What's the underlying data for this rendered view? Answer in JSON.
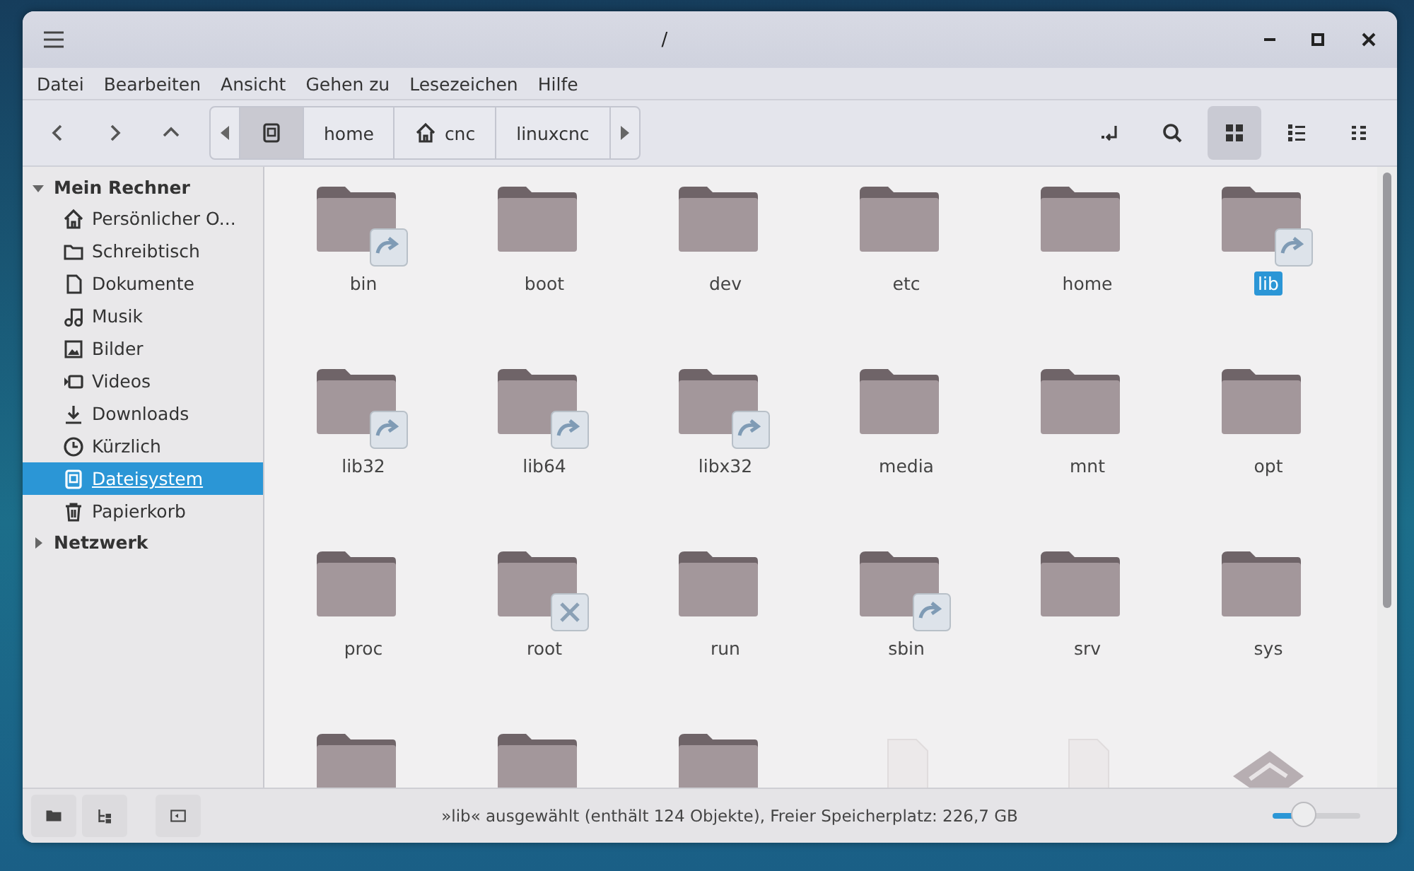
{
  "window": {
    "title": "/"
  },
  "menu": [
    "Datei",
    "Bearbeiten",
    "Ansicht",
    "Gehen zu",
    "Lesezeichen",
    "Hilfe"
  ],
  "path": [
    {
      "kind": "drive",
      "selected": true
    },
    {
      "kind": "plain",
      "label": "home",
      "selected": false
    },
    {
      "kind": "home",
      "label": "cnc",
      "selected": false
    },
    {
      "kind": "plain",
      "label": "linuxcnc",
      "selected": false
    }
  ],
  "view_modes": [
    {
      "kind": "icons",
      "selected": true
    },
    {
      "kind": "list",
      "selected": false
    },
    {
      "kind": "compact",
      "selected": false
    }
  ],
  "sidebar": [
    {
      "label": "Mein Rechner",
      "expanded": true,
      "items": [
        {
          "kind": "home",
          "label": "Persönlicher O...",
          "selected": false
        },
        {
          "kind": "folder",
          "label": "Schreibtisch",
          "selected": false
        },
        {
          "kind": "document",
          "label": "Dokumente",
          "selected": false
        },
        {
          "kind": "music",
          "label": "Musik",
          "selected": false
        },
        {
          "kind": "image",
          "label": "Bilder",
          "selected": false
        },
        {
          "kind": "video",
          "label": "Videos",
          "selected": false
        },
        {
          "kind": "download",
          "label": "Downloads",
          "selected": false
        },
        {
          "kind": "clock",
          "label": "Kürzlich",
          "selected": false
        },
        {
          "kind": "drive",
          "label": "Dateisystem",
          "selected": true
        },
        {
          "kind": "trash",
          "label": "Papierkorb",
          "selected": false
        }
      ]
    },
    {
      "label": "Netzwerk",
      "expanded": false
    }
  ],
  "files": [
    {
      "name": "bin",
      "kind": "link",
      "selected": false
    },
    {
      "name": "boot",
      "kind": "folder",
      "selected": false
    },
    {
      "name": "dev",
      "kind": "folder",
      "selected": false
    },
    {
      "name": "etc",
      "kind": "folder",
      "selected": false
    },
    {
      "name": "home",
      "kind": "folder",
      "selected": false
    },
    {
      "name": "lib",
      "kind": "link",
      "selected": true
    },
    {
      "name": "lib32",
      "kind": "link",
      "selected": false
    },
    {
      "name": "lib64",
      "kind": "link",
      "selected": false
    },
    {
      "name": "libx32",
      "kind": "link",
      "selected": false
    },
    {
      "name": "media",
      "kind": "folder",
      "selected": false
    },
    {
      "name": "mnt",
      "kind": "folder",
      "selected": false
    },
    {
      "name": "opt",
      "kind": "folder",
      "selected": false
    },
    {
      "name": "proc",
      "kind": "folder",
      "selected": false
    },
    {
      "name": "root",
      "kind": "locked",
      "selected": false
    },
    {
      "name": "run",
      "kind": "folder",
      "selected": false
    },
    {
      "name": "sbin",
      "kind": "link",
      "selected": false
    },
    {
      "name": "srv",
      "kind": "folder",
      "selected": false
    },
    {
      "name": "sys",
      "kind": "folder",
      "selected": false
    }
  ],
  "partial_files": [
    {
      "kind": "folder"
    },
    {
      "kind": "folder"
    },
    {
      "kind": "folder"
    },
    {
      "kind": "file"
    },
    {
      "kind": "file"
    },
    {
      "kind": "image"
    }
  ],
  "status_bar": {
    "text": "»lib« ausgewählt (enthält 124 Objekte), Freier Speicherplatz: 226,7 GB",
    "zoom": {
      "level": 0.35
    }
  }
}
